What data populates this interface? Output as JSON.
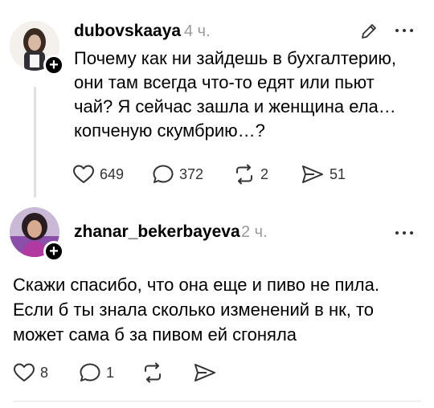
{
  "posts": [
    {
      "username": "dubovskaaya",
      "timestamp": "4 ч.",
      "text": "Почему как ни зайдешь в бухгалтерию,\nони там всегда что-то едят или пьют\nчай? Я сейчас зашла и женщина ела…\nкопченую скумбрию…?",
      "actions": {
        "likes": "649",
        "comments": "372",
        "reposts": "2",
        "shares": "51"
      },
      "icons": {
        "follow": "plus-icon",
        "edit": "pencil-icon",
        "more": "more-dots-icon",
        "like": "heart-icon",
        "comment": "comment-bubble-icon",
        "repost": "repost-icon",
        "share": "send-icon"
      }
    },
    {
      "username": "zhanar_bekerbayeva",
      "timestamp": "2 ч.",
      "text": "Скажи спасибо, что она еще и пиво не пила.\nЕсли б ты знала сколько изменений в нк, то\nможет сама б за пивом ей сгоняла",
      "actions": {
        "likes": "8",
        "comments": "1"
      },
      "icons": {
        "follow": "plus-icon",
        "more": "more-dots-icon",
        "like": "heart-icon",
        "comment": "comment-bubble-icon",
        "repost": "repost-icon",
        "share": "send-icon"
      }
    }
  ],
  "follow_symbol": "+",
  "colors": {
    "text": "#000000",
    "muted": "#9a9a9a",
    "icon": "#333333",
    "thread_line": "#e0e0e0",
    "divider": "#e6e6e6"
  }
}
